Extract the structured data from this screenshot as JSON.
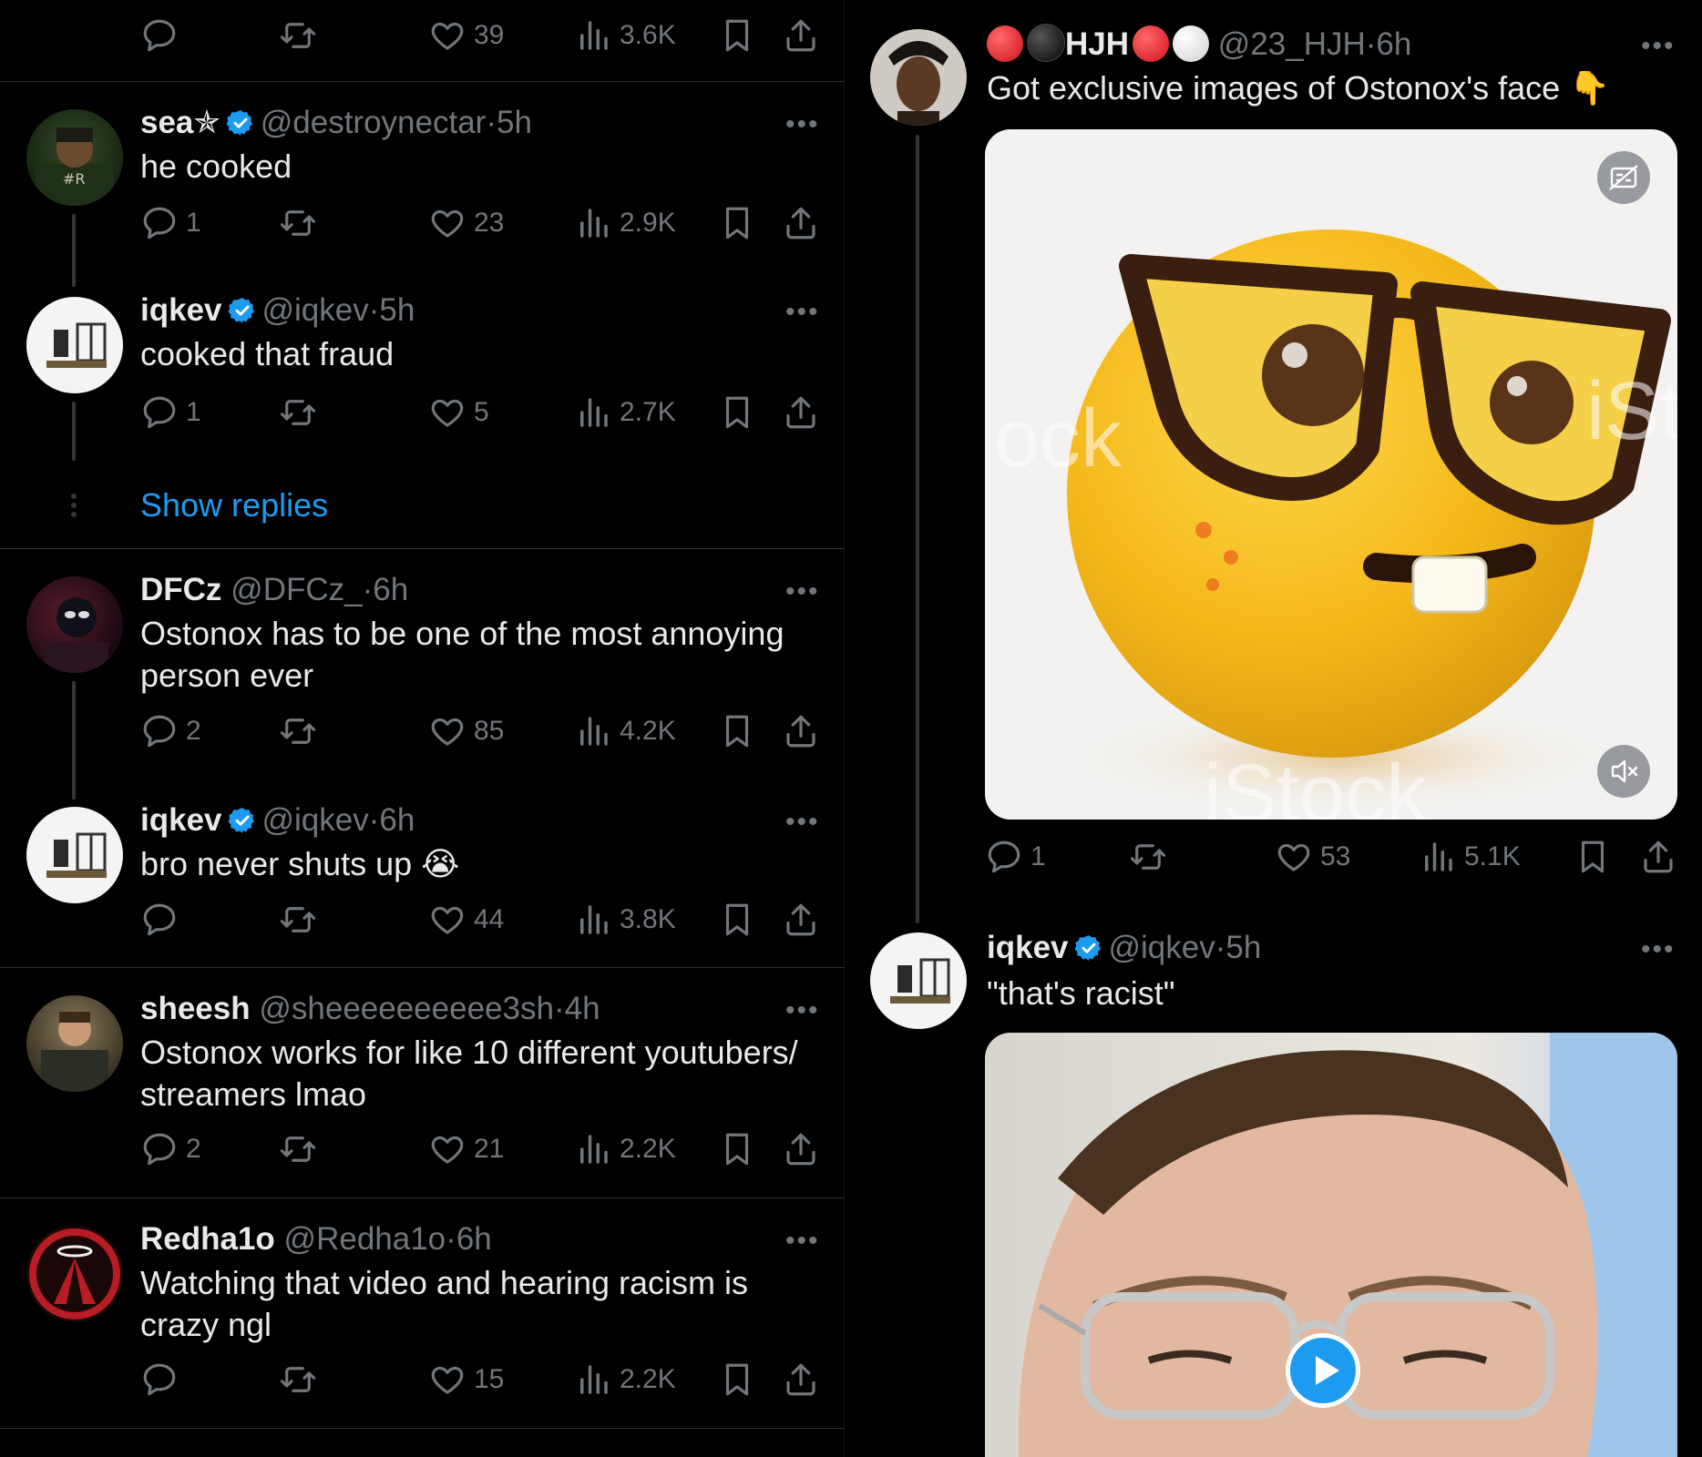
{
  "left": {
    "top_actions": {
      "replies": "",
      "likes": "39",
      "views": "3.6K"
    },
    "tweets": [
      {
        "name": "sea✯",
        "verified": true,
        "handle": "@destroynectar",
        "time": "5h",
        "text": "he cooked",
        "replies": "1",
        "likes": "23",
        "views": "2.9K"
      },
      {
        "name": "iqkev",
        "verified": true,
        "handle": "@iqkev",
        "time": "5h",
        "text": "cooked that fraud",
        "replies": "1",
        "likes": "5",
        "views": "2.7K"
      },
      {
        "name": "DFCz",
        "verified": false,
        "handle": "@DFCz_",
        "time": "6h",
        "text_lines": [
          "Ostonox has to be one of the most annoying",
          "person ever"
        ],
        "replies": "2",
        "likes": "85",
        "views": "4.2K"
      },
      {
        "name": "iqkev",
        "verified": true,
        "handle": "@iqkev",
        "time": "6h",
        "text": "bro never shuts up 😭",
        "replies": "",
        "likes": "44",
        "views": "3.8K"
      },
      {
        "name": "sheesh",
        "verified": false,
        "handle": "@sheeeeeeeeee3sh",
        "time": "4h",
        "text_lines": [
          "Ostonox works for like 10 different youtubers/",
          "streamers lmao"
        ],
        "replies": "2",
        "likes": "21",
        "views": "2.2K"
      },
      {
        "name": "Redha1o",
        "verified": false,
        "handle": "@Redha1o",
        "time": "6h",
        "text_lines": [
          "Watching that video and hearing racism is",
          "crazy ngl"
        ],
        "replies": "",
        "likes": "15",
        "views": "2.2K"
      }
    ],
    "show_replies": "Show replies"
  },
  "right": {
    "tweet1": {
      "name": "HJH",
      "handle": "@23_HJH",
      "time": "6h",
      "text": "Got exclusive images of Ostonox's face 👇",
      "replies": "1",
      "likes": "53",
      "views": "5.1K"
    },
    "tweet2": {
      "name": "iqkev",
      "verified": true,
      "handle": "@iqkev",
      "time": "5h",
      "text": "\"that's racist\""
    },
    "watermarks": [
      "ock",
      "iSt",
      "iStock"
    ]
  },
  "dot_sep": "·",
  "more_label": "•••",
  "colors": {
    "bg": "#000000",
    "text": "#e7e9ea",
    "muted": "#71767b",
    "link": "#1d9bf0",
    "verified": "#1d9bf0",
    "separator": "#2f3336"
  }
}
